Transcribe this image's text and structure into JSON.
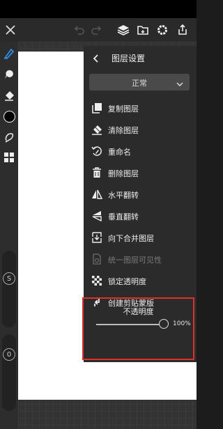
{
  "panel": {
    "title": "图层设置",
    "blend_mode": "正常",
    "items": [
      {
        "label": "复制图层",
        "icon": "duplicate-icon",
        "enabled": true
      },
      {
        "label": "清除图层",
        "icon": "eraser-icon",
        "enabled": true
      },
      {
        "label": "重命名",
        "icon": "rename-icon",
        "enabled": true
      },
      {
        "label": "删除图层",
        "icon": "trash-icon",
        "enabled": true
      },
      {
        "label": "水平翻转",
        "icon": "flip-horizontal-icon",
        "enabled": true
      },
      {
        "label": "垂直翻转",
        "icon": "flip-vertical-icon",
        "enabled": true
      },
      {
        "label": "向下合并图层",
        "icon": "merge-down-icon",
        "enabled": true
      },
      {
        "label": "统一图层可见性",
        "icon": "visibility-icon",
        "enabled": false
      },
      {
        "label": "锁定透明度",
        "icon": "checker-icon",
        "enabled": true
      },
      {
        "label": "创建剪贴蒙版",
        "icon": "clip-mask-icon",
        "enabled": true
      }
    ],
    "opacity": {
      "label": "不透明度",
      "value": "100%",
      "level": 1.0
    }
  },
  "left_toolbar": {
    "size_slider_label": "S",
    "opacity_slider_label": "0"
  },
  "colors": {
    "highlight": "#e0302a",
    "accent": "#2f8de4",
    "panel_bg": "#2b2b2b"
  }
}
